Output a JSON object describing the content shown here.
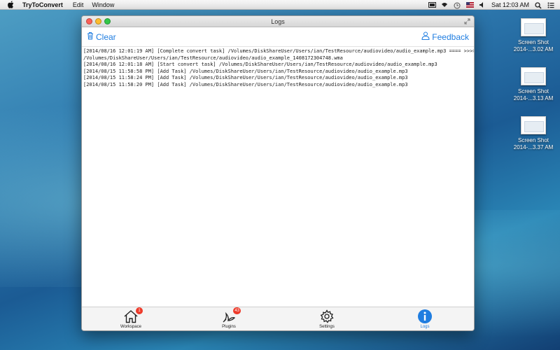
{
  "menubar": {
    "app_name": "TryToConvert",
    "menus": [
      "Edit",
      "Window"
    ],
    "clock": "Sat 12:03 AM"
  },
  "desktop_icons": [
    {
      "line1": "Screen Shot",
      "line2": "2014-...3.02 AM"
    },
    {
      "line1": "Screen Shot",
      "line2": "2014-...3.13 AM"
    },
    {
      "line1": "Screen Shot",
      "line2": "2014-...3.37 AM"
    }
  ],
  "window": {
    "title": "Logs",
    "toolbar": {
      "clear_label": "Clear",
      "feedback_label": "Feedback"
    },
    "log_lines": [
      "[2014/08/16 12:01:19 AM] [Complete convert task] /Volumes/DiskShareUser/Users/ian/TestResource/audiovideo/audio_example.mp3 ==== >>>>>",
      "/Volumes/DiskShareUser/Users/ian/TestResource/audiovideo/audio_example_1408172304748.wma",
      "[2014/08/16 12:01:18 AM] [Start convert task] /Volumes/DiskShareUser/Users/ian/TestResource/audiovideo/audio_example.mp3",
      "[2014/08/15 11:58:58 PM] [Add Task] /Volumes/DiskShareUser/Users/ian/TestResource/audiovideo/audio_example.mp3",
      "[2014/08/15 11:58:24 PM] [Add Task] /Volumes/DiskShareUser/Users/ian/TestResource/audiovideo/audio_example.mp3",
      "[2014/08/15 11:58:20 PM] [Add Task] /Volumes/DiskShareUser/Users/ian/TestResource/audiovideo/audio_example.mp3"
    ],
    "tabs": [
      {
        "label": "Workspace",
        "badge": "1",
        "icon": "house-icon"
      },
      {
        "label": "Plugins",
        "badge": "43",
        "icon": "plugins-icon"
      },
      {
        "label": "Settings",
        "badge": "",
        "icon": "gear-icon"
      },
      {
        "label": "Logs",
        "badge": "",
        "icon": "info-icon",
        "active": true
      }
    ]
  },
  "colors": {
    "accent": "#1f7de0",
    "badge": "#ee3b2b"
  }
}
